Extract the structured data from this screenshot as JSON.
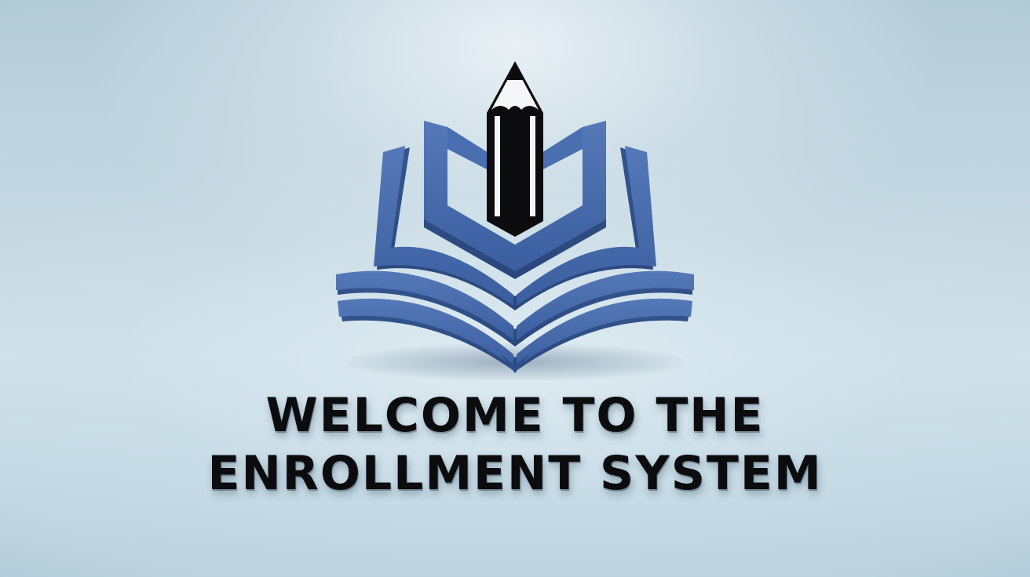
{
  "hero": {
    "headline_line1": "WELCOME TO THE",
    "headline_line2": "ENROLLMENT SYSTEM"
  },
  "logo": {
    "icon": "book-pencil-icon",
    "book_color": "#3d62a4",
    "book_color_dark": "#2f4f8c",
    "pencil_color": "#0c0c0e"
  },
  "colors": {
    "background": "#c6d9e3",
    "text": "#0c0c0e"
  }
}
